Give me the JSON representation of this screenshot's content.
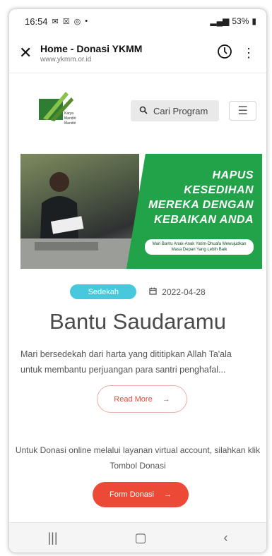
{
  "statusbar": {
    "time": "16:54",
    "battery": "53%"
  },
  "browser": {
    "title": "Home - Donasi YKMM",
    "url": "www.ykmm.or.id"
  },
  "site": {
    "logo_text": "Karya Mandiri Mandiri",
    "search_placeholder": "Cari Program"
  },
  "banner": {
    "headline": [
      "HAPUS",
      "KESEDIHAN",
      "MEREKA DENGAN",
      "KEBAIKAN ANDA"
    ],
    "subtext": "Mari Bantu Anak-Anak Yatim-Dhuafa Mewujudkan Masa Depan Yang Lebih Baik"
  },
  "post": {
    "category": "Sedekah",
    "date": "2022-04-28",
    "title": "Bantu Saudaramu",
    "excerpt": "Mari bersedekah dari harta yang dititipkan Allah Ta'ala untuk membantu perjuangan para santri penghafal...",
    "read_more": "Read More"
  },
  "donasi": {
    "info": "Untuk Donasi online melalui layanan virtual account, silahkan klik Tombol Donasi",
    "button": "Form Donasi"
  },
  "colors": {
    "accent_red": "#ec4a37",
    "tag_cyan": "#47c8dc",
    "banner_green": "#22a34a"
  }
}
